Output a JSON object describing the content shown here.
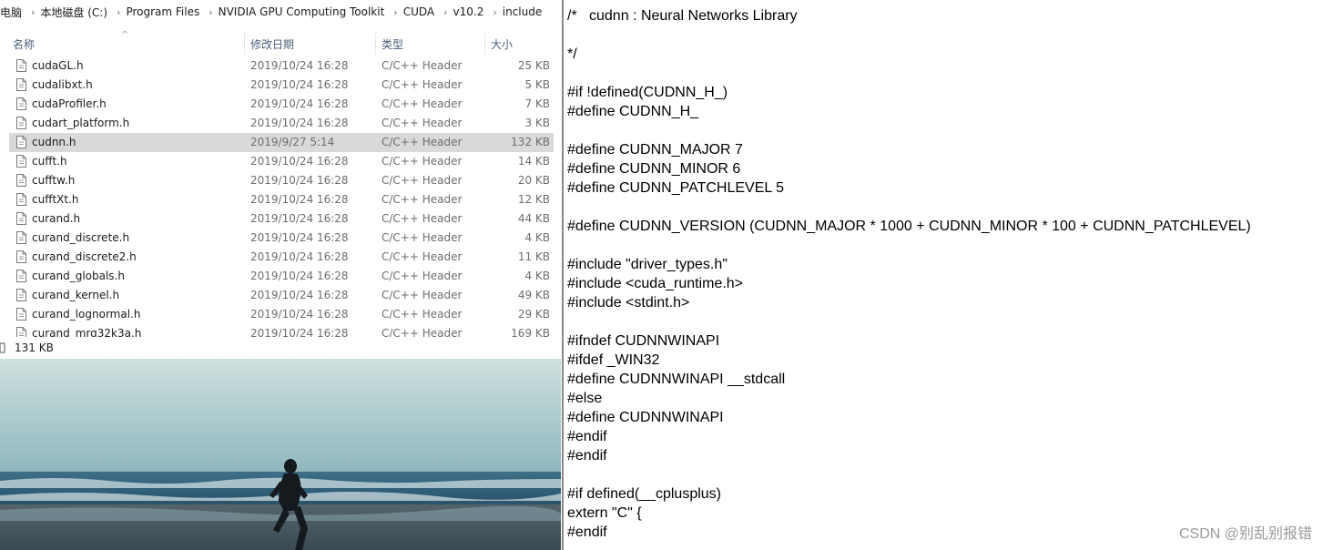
{
  "breadcrumb": [
    "电脑",
    "本地磁盘 (C:)",
    "Program Files",
    "NVIDIA GPU Computing Toolkit",
    "CUDA",
    "v10.2",
    "include"
  ],
  "columns": {
    "name": "名称",
    "date": "修改日期",
    "type": "类型",
    "size": "大小"
  },
  "files": [
    {
      "name": "cudaGL.h",
      "date": "2019/10/24 16:28",
      "type": "C/C++ Header",
      "size": "25 KB"
    },
    {
      "name": "cudalibxt.h",
      "date": "2019/10/24 16:28",
      "type": "C/C++ Header",
      "size": "5 KB"
    },
    {
      "name": "cudaProfiler.h",
      "date": "2019/10/24 16:28",
      "type": "C/C++ Header",
      "size": "7 KB"
    },
    {
      "name": "cudart_platform.h",
      "date": "2019/10/24 16:28",
      "type": "C/C++ Header",
      "size": "3 KB"
    },
    {
      "name": "cudnn.h",
      "date": "2019/9/27 5:14",
      "type": "C/C++ Header",
      "size": "132 KB",
      "selected": true
    },
    {
      "name": "cufft.h",
      "date": "2019/10/24 16:28",
      "type": "C/C++ Header",
      "size": "14 KB"
    },
    {
      "name": "cufftw.h",
      "date": "2019/10/24 16:28",
      "type": "C/C++ Header",
      "size": "20 KB"
    },
    {
      "name": "cufftXt.h",
      "date": "2019/10/24 16:28",
      "type": "C/C++ Header",
      "size": "12 KB"
    },
    {
      "name": "curand.h",
      "date": "2019/10/24 16:28",
      "type": "C/C++ Header",
      "size": "44 KB"
    },
    {
      "name": "curand_discrete.h",
      "date": "2019/10/24 16:28",
      "type": "C/C++ Header",
      "size": "4 KB"
    },
    {
      "name": "curand_discrete2.h",
      "date": "2019/10/24 16:28",
      "type": "C/C++ Header",
      "size": "11 KB"
    },
    {
      "name": "curand_globals.h",
      "date": "2019/10/24 16:28",
      "type": "C/C++ Header",
      "size": "4 KB"
    },
    {
      "name": "curand_kernel.h",
      "date": "2019/10/24 16:28",
      "type": "C/C++ Header",
      "size": "49 KB"
    },
    {
      "name": "curand_lognormal.h",
      "date": "2019/10/24 16:28",
      "type": "C/C++ Header",
      "size": "29 KB"
    },
    {
      "name": "curand_mrg32k3a.h",
      "date": "2019/10/24 16:28",
      "type": "C/C++ Header",
      "size": "169 KB"
    }
  ],
  "status": {
    "selection_size": "131 KB"
  },
  "code_lines": [
    "/*   cudnn : Neural Networks Library",
    "",
    "*/",
    "",
    "#if !defined(CUDNN_H_)",
    "#define CUDNN_H_",
    "",
    "#define CUDNN_MAJOR 7",
    "#define CUDNN_MINOR 6",
    "#define CUDNN_PATCHLEVEL 5",
    "",
    "#define CUDNN_VERSION (CUDNN_MAJOR * 1000 + CUDNN_MINOR * 100 + CUDNN_PATCHLEVEL)",
    "",
    "#include \"driver_types.h\"",
    "#include <cuda_runtime.h>",
    "#include <stdint.h>",
    "",
    "#ifndef CUDNNWINAPI",
    "#ifdef _WIN32",
    "#define CUDNNWINAPI __stdcall",
    "#else",
    "#define CUDNNWINAPI",
    "#endif",
    "#endif",
    "",
    "#if defined(__cplusplus)",
    "extern \"C\" {",
    "#endif"
  ],
  "watermark": "CSDN @别乱别报错",
  "colors": {
    "selected_row": "#d9d9d9",
    "header_text": "#4c607a",
    "secondary_text": "#6d6d6d"
  }
}
